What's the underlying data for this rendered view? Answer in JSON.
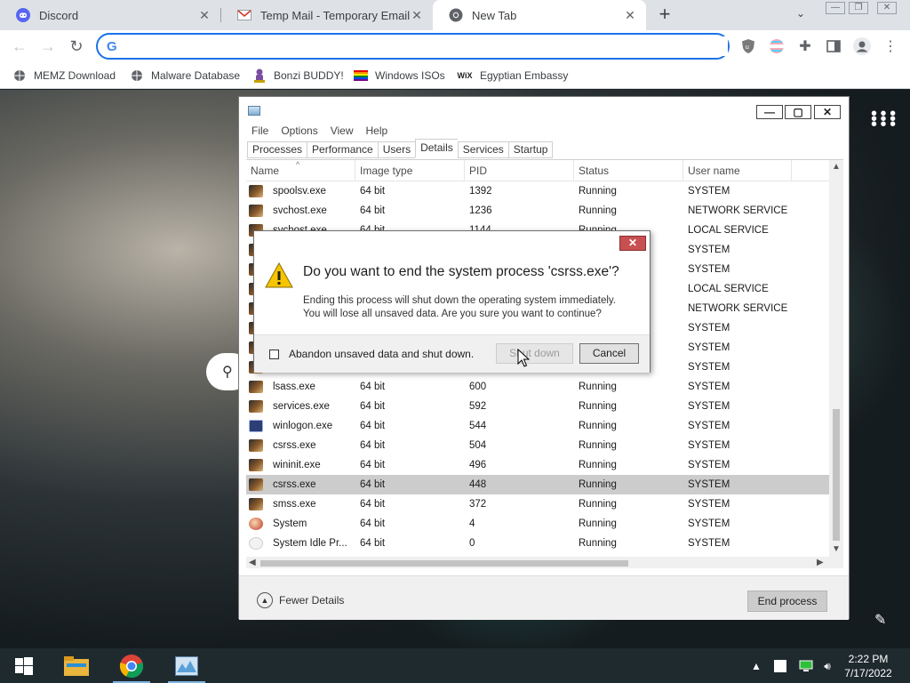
{
  "browser": {
    "tabs": [
      {
        "title": "Discord",
        "icon": "discord-icon",
        "active": false
      },
      {
        "title": "Temp Mail - Temporary Email",
        "icon": "gmail-icon",
        "active": false
      },
      {
        "title": "New Tab",
        "icon": "chrome-icon",
        "active": true
      }
    ],
    "omnibox": {
      "value": "",
      "placeholder": ""
    },
    "bookmarks": [
      {
        "label": "MEMZ Download",
        "icon": "globe-icon"
      },
      {
        "label": "Malware Database",
        "icon": "globe-icon"
      },
      {
        "label": "Bonzi BUDDY!",
        "icon": "bonzi-icon"
      },
      {
        "label": "Windows ISOs",
        "icon": "rainbow-flag-icon"
      },
      {
        "label": "Egyptian Embassy",
        "icon": "wix-icon"
      }
    ]
  },
  "task_manager": {
    "menu": [
      "File",
      "Options",
      "View",
      "Help"
    ],
    "tabs": [
      "Processes",
      "Performance",
      "Users",
      "Details",
      "Services",
      "Startup"
    ],
    "active_tab": "Details",
    "columns": [
      "Name",
      "Image type",
      "PID",
      "Status",
      "User name"
    ],
    "rows": [
      {
        "name": "spoolsv.exe",
        "type": "64 bit",
        "pid": "1392",
        "status": "Running",
        "user": "SYSTEM"
      },
      {
        "name": "svchost.exe",
        "type": "64 bit",
        "pid": "1236",
        "status": "Running",
        "user": "NETWORK SERVICE"
      },
      {
        "name": "svchost.exe",
        "type": "64 bit",
        "pid": "1144",
        "status": "Running",
        "user": "LOCAL SERVICE"
      },
      {
        "name": "",
        "type": "",
        "pid": "",
        "status": "",
        "user": "SYSTEM"
      },
      {
        "name": "",
        "type": "",
        "pid": "",
        "status": "",
        "user": "SYSTEM"
      },
      {
        "name": "",
        "type": "",
        "pid": "",
        "status": "",
        "user": "LOCAL SERVICE"
      },
      {
        "name": "",
        "type": "",
        "pid": "",
        "status": "",
        "user": "NETWORK SERVICE"
      },
      {
        "name": "",
        "type": "",
        "pid": "",
        "status": "",
        "user": "SYSTEM"
      },
      {
        "name": "",
        "type": "",
        "pid": "",
        "status": "",
        "user": "SYSTEM"
      },
      {
        "name": "",
        "type": "",
        "pid": "",
        "status": "",
        "user": "SYSTEM"
      },
      {
        "name": "lsass.exe",
        "type": "64 bit",
        "pid": "600",
        "status": "Running",
        "user": "SYSTEM"
      },
      {
        "name": "services.exe",
        "type": "64 bit",
        "pid": "592",
        "status": "Running",
        "user": "SYSTEM"
      },
      {
        "name": "winlogon.exe",
        "type": "64 bit",
        "pid": "544",
        "status": "Running",
        "user": "SYSTEM"
      },
      {
        "name": "csrss.exe",
        "type": "64 bit",
        "pid": "504",
        "status": "Running",
        "user": "SYSTEM"
      },
      {
        "name": "wininit.exe",
        "type": "64 bit",
        "pid": "496",
        "status": "Running",
        "user": "SYSTEM"
      },
      {
        "name": "csrss.exe",
        "type": "64 bit",
        "pid": "448",
        "status": "Running",
        "user": "SYSTEM",
        "selected": true
      },
      {
        "name": "smss.exe",
        "type": "64 bit",
        "pid": "372",
        "status": "Running",
        "user": "SYSTEM"
      },
      {
        "name": "System",
        "type": "64 bit",
        "pid": "4",
        "status": "Running",
        "user": "SYSTEM"
      },
      {
        "name": "System Idle Pr...",
        "type": "64 bit",
        "pid": "0",
        "status": "Running",
        "user": "SYSTEM"
      }
    ],
    "fewer_details": "Fewer Details",
    "end_process": "End process"
  },
  "dialog": {
    "title": "Do you want to end the system process 'csrss.exe'?",
    "body_line1": "Ending this process will shut down the operating system immediately.",
    "body_line2": "You will lose all unsaved data. Are you sure you want to continue?",
    "checkbox_label": "Abandon unsaved data and shut down.",
    "checkbox_checked": false,
    "shutdown_label": "Shut down",
    "cancel_label": "Cancel"
  },
  "taskbar": {
    "time": "2:22 PM",
    "date": "7/17/2022"
  },
  "colors": {
    "accent": "#1a73e8",
    "close_red": "#c75050",
    "selected_row": "#cccccc",
    "taskbar": "#1f2a2f"
  }
}
